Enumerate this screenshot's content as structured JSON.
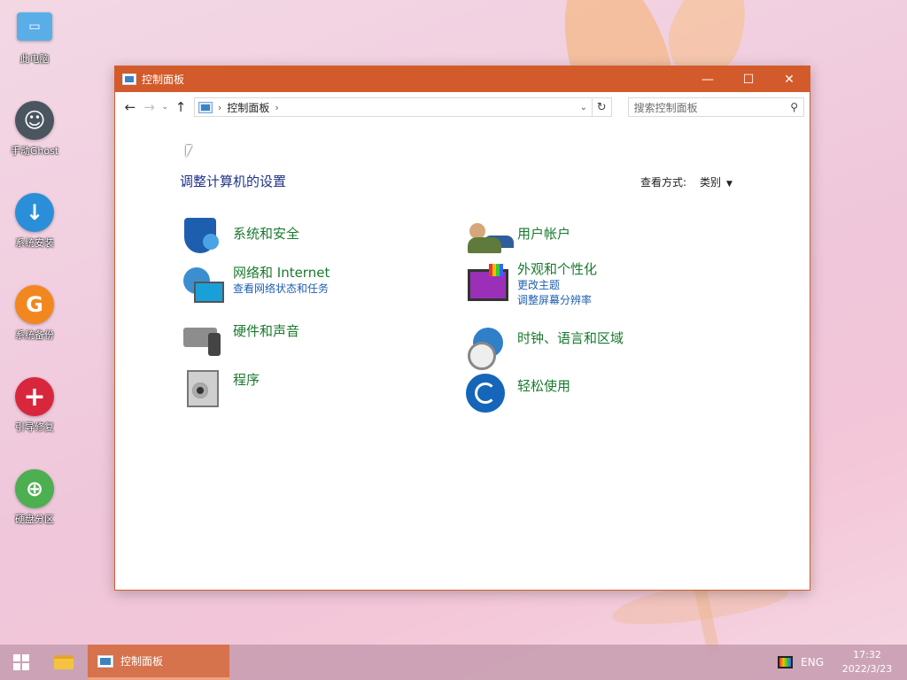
{
  "desktop": {
    "icons": [
      {
        "label": "此电脑",
        "icon": "computer-icon",
        "color": "#5aaee8"
      },
      {
        "label": "手动Ghost",
        "icon": "ghost-icon",
        "color": "#4a5560"
      },
      {
        "label": "系统安装",
        "icon": "download-icon",
        "color": "#2a8fd8"
      },
      {
        "label": "系统备份",
        "icon": "backup-icon",
        "color": "#f2871f"
      },
      {
        "label": "引导修复",
        "icon": "plus-icon",
        "color": "#d8273d"
      },
      {
        "label": "硬盘分区",
        "icon": "partition-icon",
        "color": "#4caf50"
      }
    ]
  },
  "window": {
    "title": "控制面板",
    "controls": {
      "minimize": "—",
      "maximize": "☐",
      "close": "✕"
    },
    "titlebar_color": "#d35a2a"
  },
  "addressbar": {
    "back": "←",
    "forward": "→",
    "recent": "⌄",
    "up": "↑",
    "breadcrumb": "控制面板",
    "refresh": "↻",
    "search_placeholder": "搜索控制面板"
  },
  "main": {
    "heading": "调整计算机的设置",
    "view_by_label": "查看方式:",
    "view_by_value": "类别",
    "categories": [
      {
        "title": "系统和安全",
        "links": [],
        "icon": "shield-icon"
      },
      {
        "title": "用户帐户",
        "links": [],
        "icon": "users-icon"
      },
      {
        "title": "网络和 Internet",
        "links": [
          "查看网络状态和任务"
        ],
        "icon": "network-icon"
      },
      {
        "title": "外观和个性化",
        "links": [
          "更改主题",
          "调整屏幕分辨率"
        ],
        "icon": "appearance-icon"
      },
      {
        "title": "硬件和声音",
        "links": [],
        "icon": "hardware-sound-icon"
      },
      {
        "title": "时钟、语言和区域",
        "links": [],
        "icon": "clock-globe-icon"
      },
      {
        "title": "程序",
        "links": [],
        "icon": "programs-icon"
      },
      {
        "title": "轻松使用",
        "links": [],
        "icon": "ease-of-access-icon"
      }
    ]
  },
  "taskbar": {
    "task_label": "控制面板",
    "lang": "ENG",
    "time": "17:32",
    "date": "2022/3/23"
  }
}
